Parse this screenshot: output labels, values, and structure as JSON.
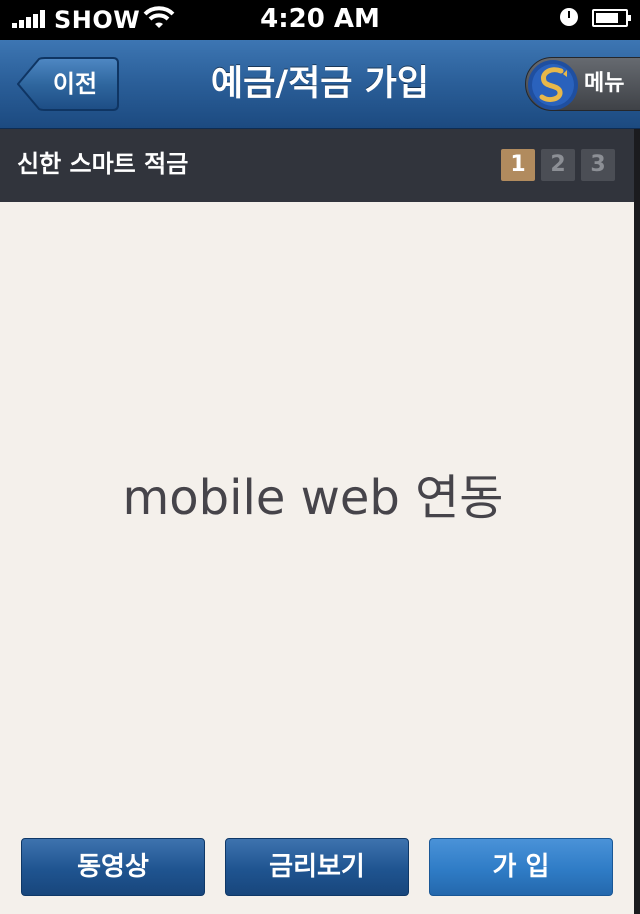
{
  "status_bar": {
    "carrier": "SHOW",
    "time": "4:20 AM",
    "icons": [
      "signal-icon",
      "wifi-icon",
      "lock-rotation-icon",
      "battery-icon"
    ]
  },
  "nav": {
    "back_label": "이전",
    "title": "예금/적금 가입",
    "menu_label": "메뉴",
    "logo_icon": "shinhan-logo-icon"
  },
  "product": {
    "name": "신한 스마트 적금",
    "steps": [
      "1",
      "2",
      "3"
    ],
    "active_step": 1
  },
  "main": {
    "text": "mobile web 연동"
  },
  "bottom_buttons": {
    "video_label": "동영상",
    "rates_label": "금리보기",
    "join_label": "가 입"
  },
  "colors": {
    "nav_blue": "#2a5e98",
    "product_bar": "#31343c",
    "active_step": "#b18b5e",
    "background": "#f4f0eb"
  }
}
